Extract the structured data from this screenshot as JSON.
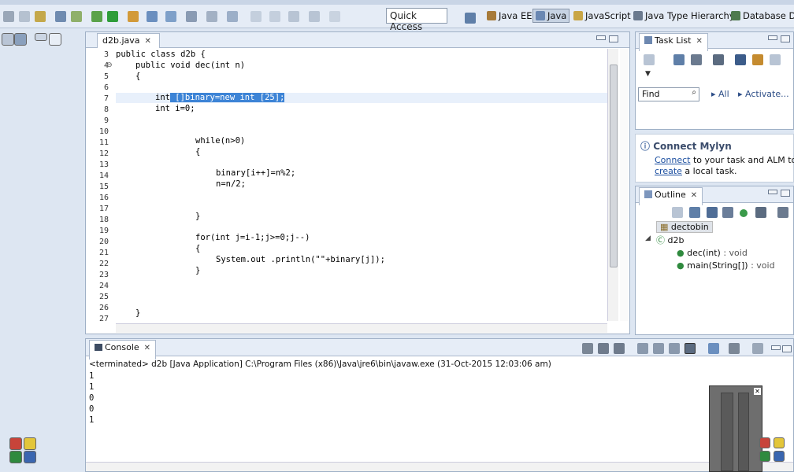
{
  "toolbar": {
    "quick_access": "Quick Access",
    "perspectives": [
      "Java EE",
      "Java",
      "JavaScript",
      "Java Type Hierarchy",
      "Database Deb"
    ]
  },
  "editor": {
    "tab_label": "d2b.java",
    "line_numbers": [
      "3",
      "4",
      "5",
      "6",
      "7",
      "8",
      "9",
      "10",
      "11",
      "12",
      "13",
      "14",
      "15",
      "16",
      "17",
      "18",
      "19",
      "20",
      "21",
      "22",
      "23",
      "24",
      "25",
      "26",
      "27"
    ],
    "lines": {
      "l3": "public class d2b {",
      "l4": "public void dec(int n)",
      "l5": "{",
      "l7_pre": "int",
      "l7_sel": " []binary=new int [25];",
      "l8": "int i=0;",
      "l11": "while(n>0)",
      "l12": "{",
      "l14": "binary[i++]=n%2;",
      "l15": "n=n/2;",
      "l18": "}",
      "l20": "for(int j=i-1;j>=0;j--)",
      "l21": "{",
      "l22": "System.out .println(\"\"+binary[j]);",
      "l23": "}",
      "l27": "}"
    }
  },
  "tasklist": {
    "tab_label": "Task List",
    "find_placeholder": "Find",
    "all_label": "All",
    "activate_label": "Activate..."
  },
  "mylyn": {
    "title": "Connect Mylyn",
    "connect_link": "Connect",
    "connect_rest": " to your task and ALM tools o",
    "create_link": "create",
    "create_rest": " a local task."
  },
  "outline": {
    "tab_label": "Outline",
    "package": "dectobin",
    "class": "d2b",
    "members": [
      {
        "name": "dec(int)",
        "type": " : void"
      },
      {
        "name": "main(String[])",
        "type": " : void"
      }
    ]
  },
  "console": {
    "tab_label": "Console",
    "status": "<terminated> d2b [Java Application] C:\\Program Files (x86)\\Java\\jre6\\bin\\javaw.exe (31-Oct-2015 12:03:06 am)",
    "output": [
      "1",
      "1",
      "0",
      "0",
      "1"
    ]
  }
}
